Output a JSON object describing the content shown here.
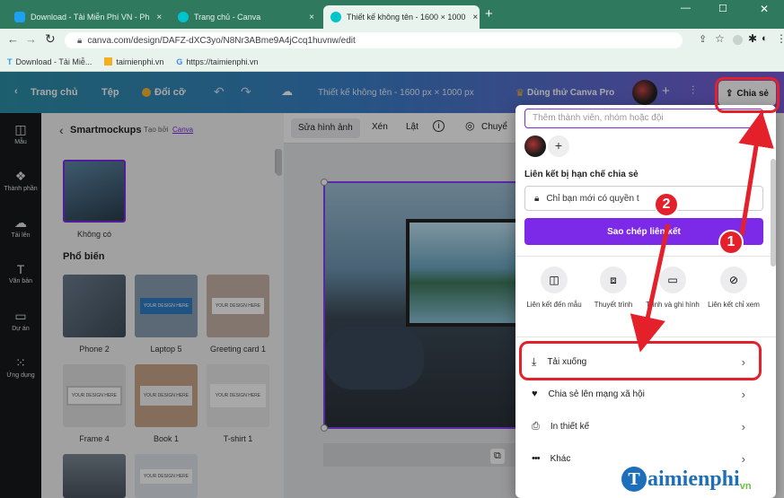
{
  "browser": {
    "tabs": [
      {
        "title": "Download - Tải Miễn Phí VN - Ph",
        "close": "×"
      },
      {
        "title": "Trang chủ - Canva",
        "close": "×"
      },
      {
        "title": "Thiết kế không tên - 1600 × 1000",
        "close": "×"
      }
    ],
    "new_tab": "+",
    "url": "canva.com/design/DAFZ-dXC3yo/N8Nr3ABme9A4jCcq1huvnw/edit",
    "bookmarks": [
      "Download - Tải Miễ...",
      "taimienphi.vn",
      "https://taimienphi.vn"
    ],
    "window_controls": {
      "minimize": "—",
      "maximize": "☐",
      "close": "✕"
    }
  },
  "canva_header": {
    "home": "Trang chủ",
    "file": "Tệp",
    "resize": "Đổi cỡ",
    "doc_title": "Thiết kế không tên - 1600 px × 1000 px",
    "try_pro": "Dùng thử Canva Pro",
    "share": "Chia sẻ"
  },
  "rail": [
    {
      "icon": "template-icon",
      "label": "Mẫu"
    },
    {
      "icon": "elements-icon",
      "label": "Thành phần"
    },
    {
      "icon": "upload-icon",
      "label": "Tải lên"
    },
    {
      "icon": "text-icon",
      "label": "Văn bản"
    },
    {
      "icon": "projects-icon",
      "label": "Dự án"
    },
    {
      "icon": "apps-icon",
      "label": "Ứng dụng"
    }
  ],
  "panel": {
    "title": "Smartmockups",
    "byline": "Tạo bởi",
    "byline_link": "Canva",
    "none_label": "Không có",
    "section": "Phổ biến",
    "items": [
      "Phone 2",
      "Laptop 5",
      "Greeting card 1",
      "Frame 4",
      "Book 1",
      "T-shirt 1"
    ],
    "mock_text": "YOUR DESIGN HERE"
  },
  "toolbar": {
    "edit_image": "Sửa hình ảnh",
    "crop": "Xén",
    "flip": "Lật",
    "animate": "Chuyể"
  },
  "share_menu": {
    "invite_placeholder": "Thêm thành viên, nhóm hoặc đội",
    "link_title": "Liên kết bị hạn chế chia sẻ",
    "link_access": "Chỉ bạn mới có quyền t",
    "copy_link": "Sao chép liên kết",
    "options": [
      {
        "icon": "template-link-icon",
        "label": "Liên kết đến mẫu"
      },
      {
        "icon": "present-icon",
        "label": "Thuyết trình"
      },
      {
        "icon": "record-icon",
        "label": "Trình và ghi hình"
      },
      {
        "icon": "view-link-icon",
        "label": "Liên kết chỉ xem"
      }
    ],
    "items": [
      {
        "icon": "download-icon",
        "label": "Tải xuống"
      },
      {
        "icon": "social-share-icon",
        "label": "Chia sẻ lên mạng xã hội"
      },
      {
        "icon": "print-icon",
        "label": "In thiết kế"
      },
      {
        "icon": "more-icon",
        "label": "Khác"
      }
    ]
  },
  "annotations": {
    "badge1": "1",
    "badge2": "2",
    "watermark": "aimienphi",
    "watermark_suffix": "vn"
  },
  "colors": {
    "accent": "#7d2ae8",
    "annotation_red": "#e4212b"
  }
}
